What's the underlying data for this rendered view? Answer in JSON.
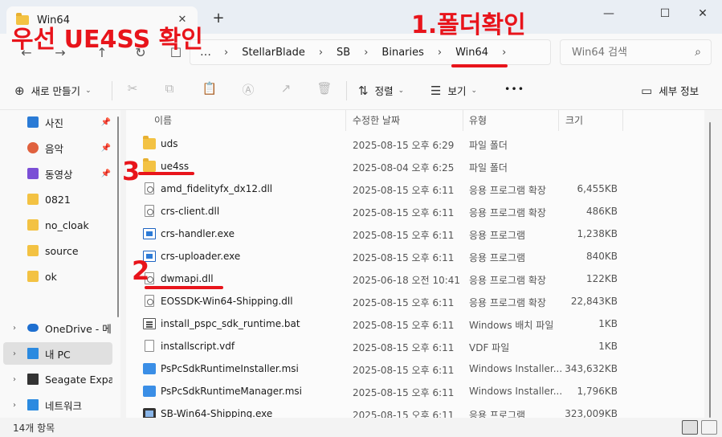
{
  "window": {
    "tab_title": "Win64",
    "tab_close": "✕",
    "new_tab": "+",
    "controls": {
      "minimize": "—",
      "maximize": "☐",
      "close": "✕"
    }
  },
  "nav": {
    "back": "←",
    "forward": "→",
    "up": "↑",
    "refresh": "↻",
    "view": "☐"
  },
  "address": {
    "overflow": "…",
    "crumbs": [
      "StellarBlade",
      "SB",
      "Binaries",
      "Win64"
    ],
    "separator": "›",
    "trailing_chevron": "›"
  },
  "search": {
    "placeholder": "Win64 검색",
    "icon": "search-icon"
  },
  "commands": {
    "new_label": "새로 만들기",
    "sort_label": "정렬",
    "view_label": "보기",
    "more": "•••",
    "details_pane": "세부 정보",
    "icons": {
      "new": "⊕",
      "sort": "⇅",
      "view": "☰",
      "details": "▭",
      "cut": "✂",
      "copy": "⧉",
      "paste": "📋",
      "rename": "Ⓐ",
      "share": "↗",
      "delete": "🗑"
    }
  },
  "sidebar": {
    "items": [
      {
        "label": "사진",
        "icon": "photos-icon",
        "pinned": true,
        "color": "#2a7bd6"
      },
      {
        "label": "음악",
        "icon": "music-icon",
        "pinned": true,
        "color": "#e0613e"
      },
      {
        "label": "동영상",
        "icon": "videos-icon",
        "pinned": true,
        "color": "#7b4fd6"
      },
      {
        "label": "0821",
        "icon": "folder-icon",
        "pinned": false
      },
      {
        "label": "no_cloak",
        "icon": "folder-icon",
        "pinned": false
      },
      {
        "label": "source",
        "icon": "folder-icon",
        "pinned": false
      },
      {
        "label": "ok",
        "icon": "folder-icon",
        "pinned": false
      },
      {
        "label": "OneDrive - 메티",
        "icon": "onedrive-icon",
        "pinned": false
      },
      {
        "label": "내 PC",
        "icon": "pc-icon",
        "pinned": false,
        "selected": true
      },
      {
        "label": "Seagate Expans",
        "icon": "drive-icon",
        "pinned": false
      },
      {
        "label": "네트워크",
        "icon": "network-icon",
        "pinned": false
      }
    ],
    "pin_glyph": "📌",
    "expand_glyph": "›"
  },
  "columns": {
    "name": "이름",
    "modified": "수정한 날짜",
    "type": "유형",
    "size": "크기",
    "sort_arrow": "^"
  },
  "files": [
    {
      "name": "uds",
      "date": "2025-08-15 오후 6:29",
      "type": "파일 폴더",
      "size": "",
      "kind": "folder"
    },
    {
      "name": "ue4ss",
      "date": "2025-08-04 오후 6:25",
      "type": "파일 폴더",
      "size": "",
      "kind": "folder"
    },
    {
      "name": "amd_fidelityfx_dx12.dll",
      "date": "2025-08-15 오후 6:11",
      "type": "응용 프로그램 확장",
      "size": "6,455KB",
      "kind": "dll"
    },
    {
      "name": "crs-client.dll",
      "date": "2025-08-15 오후 6:11",
      "type": "응용 프로그램 확장",
      "size": "486KB",
      "kind": "dll"
    },
    {
      "name": "crs-handler.exe",
      "date": "2025-08-15 오후 6:11",
      "type": "응용 프로그램",
      "size": "1,238KB",
      "kind": "exe"
    },
    {
      "name": "crs-uploader.exe",
      "date": "2025-08-15 오후 6:11",
      "type": "응용 프로그램",
      "size": "840KB",
      "kind": "exe"
    },
    {
      "name": "dwmapi.dll",
      "date": "2025-06-18 오전 10:41",
      "type": "응용 프로그램 확장",
      "size": "122KB",
      "kind": "dll"
    },
    {
      "name": "EOSSDK-Win64-Shipping.dll",
      "date": "2025-08-15 오후 6:11",
      "type": "응용 프로그램 확장",
      "size": "22,843KB",
      "kind": "dll"
    },
    {
      "name": "install_pspc_sdk_runtime.bat",
      "date": "2025-08-15 오후 6:11",
      "type": "Windows 배치 파일",
      "size": "1KB",
      "kind": "bat"
    },
    {
      "name": "installscript.vdf",
      "date": "2025-08-15 오후 6:11",
      "type": "VDF 파일",
      "size": "1KB",
      "kind": "file"
    },
    {
      "name": "PsPcSdkRuntimeInstaller.msi",
      "date": "2025-08-15 오후 6:11",
      "type": "Windows Installer...",
      "size": "343,632KB",
      "kind": "msi"
    },
    {
      "name": "PsPcSdkRuntimeManager.msi",
      "date": "2025-08-15 오후 6:11",
      "type": "Windows Installer...",
      "size": "1,796KB",
      "kind": "msi"
    },
    {
      "name": "SB-Win64-Shipping.exe",
      "date": "2025-08-15 오후 6:11",
      "type": "응용 프로그램",
      "size": "323,009KB",
      "kind": "sb"
    }
  ],
  "status": {
    "count": "14개 항목"
  },
  "annotations": {
    "title": "우선 UE4SS 확인",
    "step1": "1.폴더확인",
    "step2": "2",
    "step3": "3",
    "color": "#e8141b"
  }
}
